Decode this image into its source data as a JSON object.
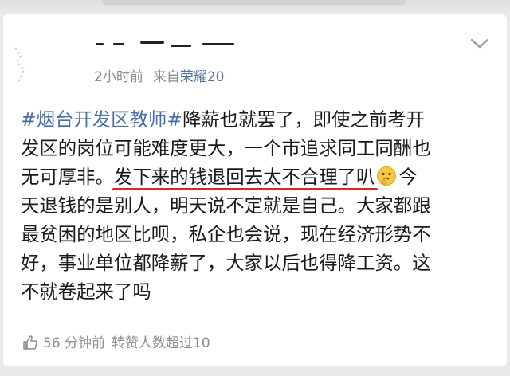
{
  "post": {
    "meta": {
      "time": "2小时前",
      "source_prefix": "来自",
      "device": "荣耀20"
    },
    "lines": [
      {
        "hashtag": "#烟台开发区教师#",
        "text": "降薪也就罢了，即使之前考开"
      },
      {
        "text": "发区的岗位可能难度更大，一个市追求同工同酬也"
      },
      {
        "before": "无可厚非。",
        "highlight": "发下来的钱退回去太不合理了叭",
        "after": "今"
      },
      {
        "text": "天退钱的是别人，明天说不定就是自己。大家都跟"
      },
      {
        "text": "最贫困的地区比呗，私企也会说，现在经济形势不"
      },
      {
        "text": "好，事业单位都降薪了，大家以后也得降工资。这"
      },
      {
        "text": "不就卷起来了吗"
      }
    ],
    "emoji_icon": "thinking-face-icon",
    "footer": {
      "time": "56 分钟前",
      "reposts": "转赞人数超过10"
    }
  },
  "colors": {
    "hashtag": "#4a6fa5",
    "device": "#5574a1",
    "underline": "#d62828",
    "meta": "#8c8c8c"
  }
}
